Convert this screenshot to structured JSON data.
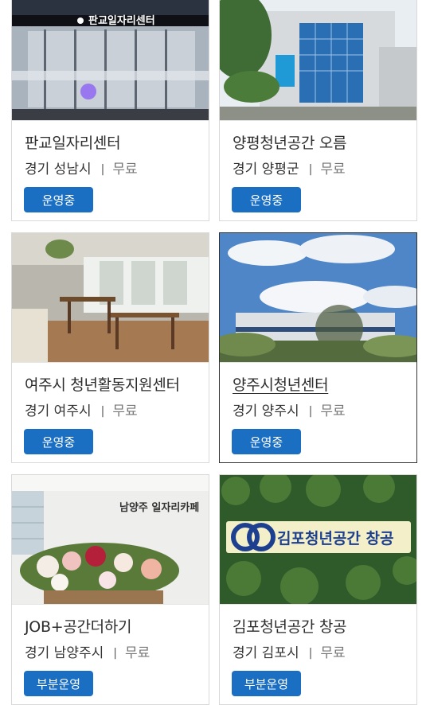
{
  "cards": [
    {
      "title": "판교일자리센터",
      "region": "경기 성남시",
      "fee": "무료",
      "status": "운영중",
      "image_icon": "office-glass-front-photo",
      "sign_text": "판교일자리센터"
    },
    {
      "title": "양평청년공간 오름",
      "region": "경기 양평군",
      "fee": "무료",
      "status": "운영중",
      "image_icon": "building-exterior-photo"
    },
    {
      "title": "여주시 청년활동지원센터",
      "region": "경기 여주시",
      "fee": "무료",
      "status": "운영중",
      "image_icon": "cafe-interior-photo"
    },
    {
      "title": "양주시청년센터",
      "region": "경기 양주시",
      "fee": "무료",
      "status": "운영중",
      "image_icon": "sky-building-photo"
    },
    {
      "title": "JOB+공간더하기",
      "region": "경기 남양주시",
      "fee": "무료",
      "status": "부분운영",
      "image_icon": "flower-basket-photo",
      "sign_text": "남양주 일자리카페"
    },
    {
      "title": "김포청년공간 창공",
      "region": "경기 김포시",
      "fee": "무료",
      "status": "부분운영",
      "image_icon": "green-wall-sign-photo",
      "sign_text": "김포청년공간 창공"
    }
  ],
  "separator": "|",
  "colors": {
    "status_bg": "#1b6fc3",
    "border": "#d9d9d9",
    "selected_border": "#333333"
  }
}
